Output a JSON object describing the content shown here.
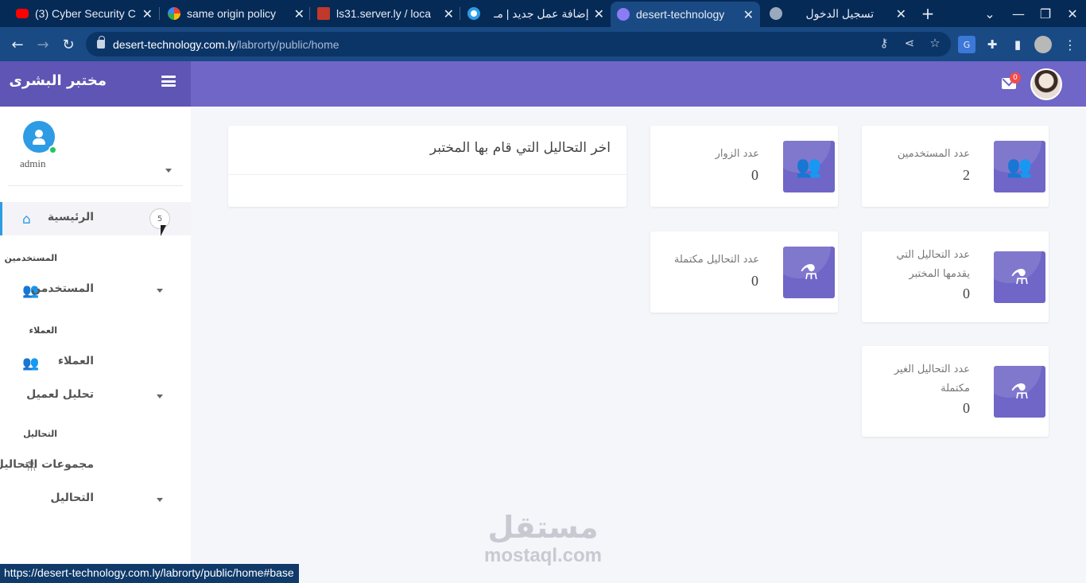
{
  "browser": {
    "tabs": [
      {
        "title": "(3) Cyber Security C",
        "favicon_color": "#ff0000",
        "active": false
      },
      {
        "title": "same origin policy",
        "favicon_color": "#ffffff",
        "active": false
      },
      {
        "title": "ls31.server.ly / loca",
        "favicon_color": "#c0392b",
        "active": false
      },
      {
        "title": "إضافة عمل جديد | مـ",
        "favicon_color": "#2e9be5",
        "active": false
      },
      {
        "title": "desert-technology",
        "favicon_color": "#8b7cf6",
        "active": true
      },
      {
        "title": "تسجيل الدخول",
        "favicon_color": "#9aa9bd",
        "active": false
      }
    ],
    "new_tab_label": "+",
    "url_host": "desert-technology.com.ly",
    "url_path": "/labrorty/public/home",
    "status_url": "https://desert-technology.com.ly/labrorty/public/home#base"
  },
  "header": {
    "brand_title": "مختبر البشرى",
    "mail_count": "0"
  },
  "sidebar": {
    "user_name": "admin",
    "items": [
      {
        "label": "الرئيسية",
        "icon": "home-icon",
        "badge": "5",
        "active": true
      },
      {
        "section": "المستخدمين"
      },
      {
        "label": "المستخدمن",
        "icon": "users-icon",
        "has_caret": true
      },
      {
        "section": "العملاء"
      },
      {
        "label": "العملاء",
        "icon": "users-icon"
      },
      {
        "label": "تحليل لعميل",
        "has_caret": true
      },
      {
        "section": "التحاليل"
      },
      {
        "label": "مجموعات التحاليل",
        "icon": "flask-icon"
      },
      {
        "label": "التحاليل",
        "has_caret": true
      }
    ]
  },
  "stats": {
    "users": {
      "label": "عدد المستخدمين",
      "value": "2",
      "icon": "users-icon"
    },
    "visitors": {
      "label": "عدد الزوار",
      "value": "0",
      "icon": "users-icon"
    },
    "provided_tests": {
      "label": "عدد التحاليل التي يقدمها المختبر",
      "value": "0",
      "icon": "flask-icon"
    },
    "completed_tests": {
      "label": "عدد التحاليل مكتملة",
      "value": "0",
      "icon": "flask-icon"
    },
    "incomplete_tests": {
      "label": "عدد التحاليل الغير مكتملة",
      "value": "0",
      "icon": "flask-icon"
    }
  },
  "latest_panel": {
    "title": "اخر التحاليل التي قام بها المختبر"
  },
  "watermark": {
    "arabic": "مستقل",
    "latin": "mostaql.com"
  }
}
